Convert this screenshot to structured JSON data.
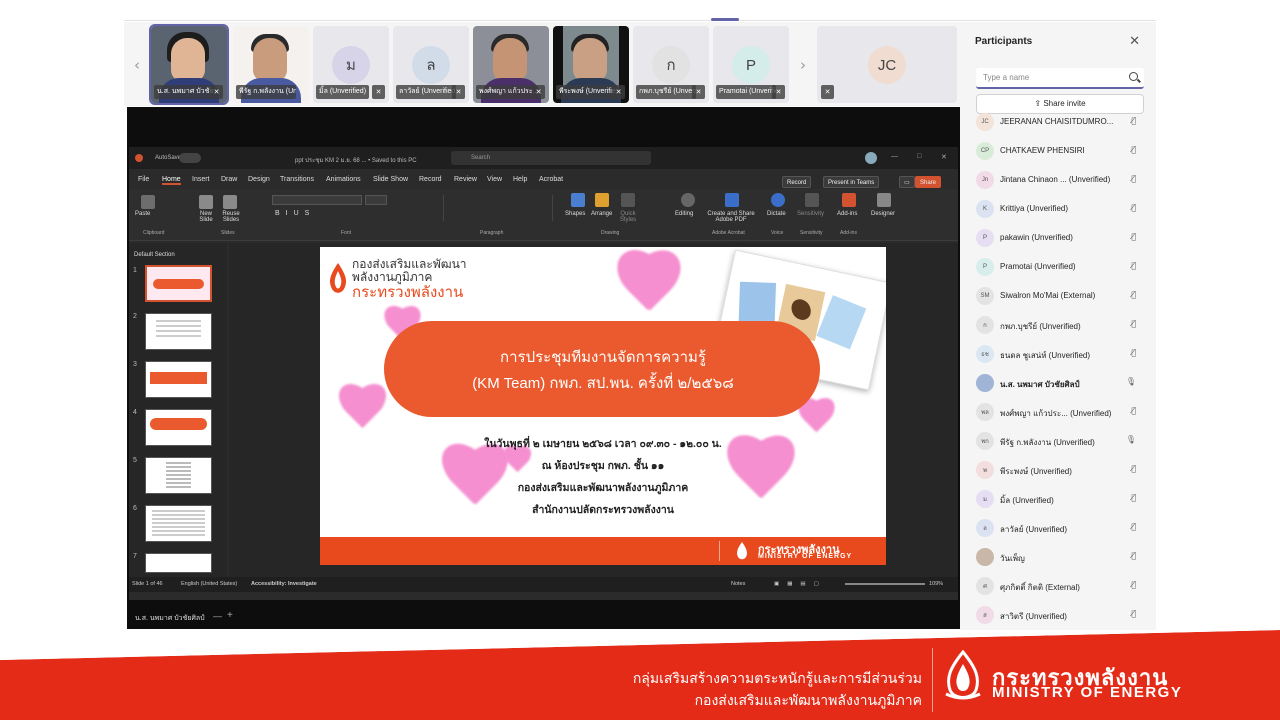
{
  "gallery": {
    "tiles": [
      {
        "name": "น.ส. นพมาศ บัวชัยศิลป์"
      },
      {
        "name": "พีรัฐ ก.พลังงาน (Unverified)"
      },
      {
        "name": "มิ้ล (Unverified)",
        "initial": "ม"
      },
      {
        "name": "ลาวัลย์ (Unverified)",
        "initial": "ล"
      },
      {
        "name": "พงศ์พญา แก้วประ..."
      },
      {
        "name": "พีระพงษ์ (Unverified)"
      },
      {
        "name": "กพภ.บุชรีย์ (Unverified)",
        "initial": "ก"
      },
      {
        "name": "Pramotai (Unverified)",
        "initial": "P"
      },
      {
        "name": "",
        "initial": "JC"
      }
    ]
  },
  "ppt": {
    "autosave": "AutoSave",
    "filename": "ppt ประชุม KM 2 ม.ย. 68 ... • Saved to this PC",
    "search": "Search",
    "menu": [
      "File",
      "Home",
      "Insert",
      "Draw",
      "Design",
      "Transitions",
      "Animations",
      "Slide Show",
      "Record",
      "Review",
      "View",
      "Help",
      "Acrobat"
    ],
    "record": "Record",
    "present": "Present in Teams",
    "share": "Share",
    "ribbon_labels": [
      "Paste",
      "New Slide",
      "Reuse Slides",
      "Shapes",
      "Arrange",
      "Quick Styles",
      "Editing",
      "Create and Share Adobe PDF",
      "Dictate",
      "Sensitivity",
      "Add-ins",
      "Designer"
    ],
    "ribbon_groups": [
      "Clipboard",
      "Slides",
      "Font",
      "Paragraph",
      "Drawing",
      "Adobe Acrobat",
      "Voice",
      "Sensitivity",
      "Add-ins"
    ],
    "section": "Default Section",
    "slide_numbers": [
      "1",
      "2",
      "3",
      "4",
      "5",
      "6",
      "7"
    ],
    "slide": {
      "org_line1": "กองส่งเสริมและพัฒนา",
      "org_line2": "พลังงานภูมิภาค",
      "ministry_th": "กระทรวงพลังงาน",
      "title1": "การประชุมทีมงานจัดการความรู้",
      "title2": "(KM Team) กพภ. สป.พน. ครั้งที่ ๒/๒๕๖๘",
      "date": "ในวันพุธที่ ๒ เมษายน ๒๕๖๘ เวลา ๐๙.๓๐ - ๑๒.๐๐ น.",
      "room": "ณ ห้องประชุม กพภ. ชั้น ๑๑",
      "dept": "กองส่งเสริมและพัฒนาพลังงานภูมิภาค",
      "office": "สำนักงานปลัดกระทรวงพลังงาน",
      "footer_en": "MINISTRY OF ENERGY",
      "footer_th": "กระทรวงพลังงาน"
    },
    "status_slide": "Slide 1 of 46",
    "status_lang": "English (United States)",
    "status_access": "Accessibility: Investigate",
    "status_notes": "Notes",
    "status_zoom": "109%"
  },
  "taskbar_name": "น.ส. นพมาศ บัวชัยศิลป์",
  "participants": {
    "title": "Participants",
    "search_placeholder": "Type a name",
    "share_invite": "Share invite",
    "list": [
      {
        "initials": "JC",
        "name": "JEERANAN CHAISITDUMRO...",
        "bg": "#f3e3d8"
      },
      {
        "initials": "CP",
        "name": "CHATKAEW PHENSIRI",
        "bg": "#d9ecd9"
      },
      {
        "initials": "Jn",
        "name": "Jintana Chinaon ... (Unverified)",
        "bg": "#f1dbe6"
      },
      {
        "initials": "K",
        "name": "Krittiya (Unverified)",
        "bg": "#dbe3f3"
      },
      {
        "initials": "P",
        "name": "pakawin (Unverified)",
        "bg": "#e6def2"
      },
      {
        "initials": "P",
        "name": "Pramotai (Unverified)",
        "bg": "#d8eeec"
      },
      {
        "initials": "SM",
        "name": "Siwalron Mo'Mai (External)",
        "bg": "#e3e3e3"
      },
      {
        "initials": "ก",
        "name": "กพภ.บุชรีย์ (Unverified)",
        "bg": "#e3e3e3"
      },
      {
        "initials": "ธช",
        "name": "ธนดล ชูเสน่ห์ (Unverified)",
        "bg": "#dbe8f3"
      },
      {
        "initials": "",
        "name": "น.ส. นพมาศ บัวชัยศิลป์",
        "bg": "#9fb4d6"
      },
      {
        "initials": "พล",
        "name": "พงศ์พญา แก้วประ... (Unverified)",
        "bg": "#e3e3e3"
      },
      {
        "initials": "พก",
        "name": "พีรัฐ ก.พลังงาน (Unverified)",
        "bg": "#e3e3e3"
      },
      {
        "initials": "พ",
        "name": "พีระพงษ์ (Unverified)",
        "bg": "#f3dede"
      },
      {
        "initials": "ม",
        "name": "มิ้ล (Unverified)",
        "bg": "#e6def2"
      },
      {
        "initials": "ล",
        "name": "ลาวัลย์ (Unverified)",
        "bg": "#dbe3f3"
      },
      {
        "initials": "",
        "name": "วันเพ็ญ",
        "bg": "#c9b8a8"
      },
      {
        "initials": "ศ",
        "name": "ศุภกิตติ์ กิตติ (External)",
        "bg": "#e3e3e3"
      },
      {
        "initials": "ส",
        "name": "สาวิตรี (Unverified)",
        "bg": "#f1dbe6"
      }
    ]
  },
  "banner": {
    "line1": "กลุ่มเสริมสร้างความตระหนักรู้และการมีส่วนร่วม",
    "line2": "กองส่งเสริมและพัฒนาพลังงานภูมิภาค",
    "ministry_th": "กระทรวงพลังงาน",
    "ministry_en": "MINISTRY OF ENERGY"
  },
  "colors": {
    "accent": "#6264a7",
    "ppt_orange": "#d35230",
    "banner_red": "#e32b18",
    "slide_orange": "#ea5a2e"
  }
}
